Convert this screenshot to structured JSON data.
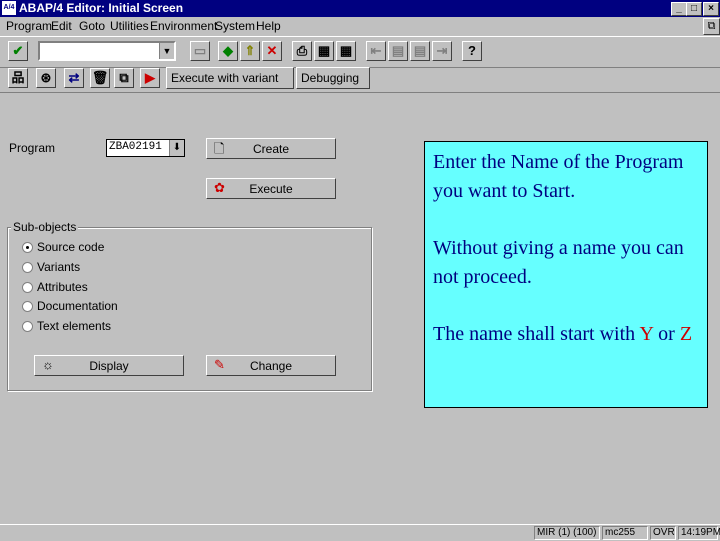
{
  "window": {
    "app_icon": "A/4",
    "title": "ABAP/4 Editor: Initial Screen",
    "min_label": "_",
    "max_label": "□",
    "close_label": "×"
  },
  "menu": [
    {
      "label": "Program"
    },
    {
      "label": "Edit"
    },
    {
      "label": "Goto"
    },
    {
      "label": "Utilities"
    },
    {
      "label": "Environment"
    },
    {
      "label": "System"
    },
    {
      "label": "Help"
    }
  ],
  "toolbar": {
    "enter_icon": "✔",
    "command_value": "",
    "dropdown_icon": "▼",
    "icons": {
      "save": "▭",
      "back": "◆",
      "exit": "⇑",
      "cancel": "✕",
      "print": "⎙",
      "find": "▦",
      "find_next": "▦",
      "first_page": "⇤",
      "prev_page": "▤",
      "next_page": "▤",
      "last_page": "⇥",
      "help": "?"
    }
  },
  "app_toolbar": {
    "icons": {
      "other_object": "品",
      "where_used": "⊛",
      "check": "⇄",
      "delete": "🗑",
      "copy": "⧉",
      "execute": "▶"
    },
    "execute_with_variant": "Execute with variant",
    "debugging": "Debugging"
  },
  "form": {
    "program_label": "Program",
    "program_value": "ZBA02191",
    "f4_icon": "⬇",
    "create_label": "Create",
    "create_icon": "🗋",
    "execute_label": "Execute",
    "execute_icon": "✿"
  },
  "subobjects": {
    "title": "Sub-objects",
    "options": [
      {
        "label": "Source code",
        "selected": true
      },
      {
        "label": "Variants",
        "selected": false
      },
      {
        "label": "Attributes",
        "selected": false
      },
      {
        "label": "Documentation",
        "selected": false
      },
      {
        "label": "Text elements",
        "selected": false
      }
    ],
    "display_label": "Display",
    "display_icon": "☼",
    "change_label": "Change",
    "change_icon": "✎"
  },
  "note": {
    "p1": "Enter the Name of the Program you want to Start.",
    "p2": "Without giving a name you can not proceed.",
    "p3_prefix": "The name shall start with ",
    "letter1": "Y",
    "p3_or": " or ",
    "letter2": "Z",
    "bg_color": "#66ffff",
    "text_color": "#000080",
    "accent_color": "#cc0000"
  },
  "status": {
    "system": "MIR (1) (100)",
    "server": "mc255",
    "mode": "OVR",
    "time": "14:19PM"
  }
}
